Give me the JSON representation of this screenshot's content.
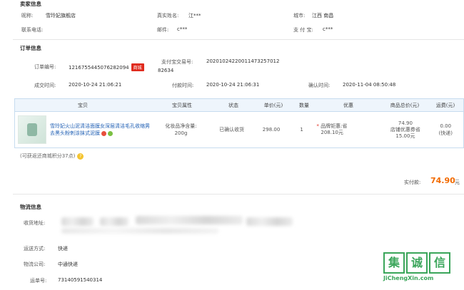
{
  "seller": {
    "title": "卖家信息",
    "nickname_label": "昵称:",
    "nickname_value": "雪玲妃旗舰店",
    "realname_label": "真实姓名:",
    "realname_value": "江***",
    "city_label": "城市:",
    "city_value": "江西 南昌",
    "phone_label": "联系电话:",
    "phone_value": "",
    "email_label": "邮件:",
    "email_value": "c***",
    "alipay_label": "支 付 宝:",
    "alipay_value": "c***"
  },
  "order": {
    "title": "订单信息",
    "order_no_label": "订单编号:",
    "order_no_value": "1216755445076282094",
    "order_badge": "商城",
    "alipay_trade_label": "支付宝交易号:",
    "alipay_trade_value_1": "20201024220011473257012",
    "alipay_trade_value_2": "82634",
    "created_label": "成交时间:",
    "created_value": "2020-10-24 21:06:21",
    "paid_label": "付款时间:",
    "paid_value": "2020-10-24 21:06:31",
    "confirmed_label": "确认时间:",
    "confirmed_value": "2020-11-04 08:50:48"
  },
  "table": {
    "headers": [
      "宝贝",
      "宝贝属性",
      "状态",
      "单价(元)",
      "数量",
      "优惠",
      "商品总价(元)",
      "运费(元)"
    ],
    "row": {
      "title": "雪玲妃火山泥清洁面膜女深层清洁毛孔收缩男去黑头粉刺涂抹式泥膜",
      "attr_1": "化妆品净含量:",
      "attr_2": "200g",
      "status": "已确认收货",
      "price": "298.00",
      "qty": "1",
      "promo_1": "品牌钜惠:省",
      "promo_2": "208.10元",
      "total_1": "74.90",
      "total_2": "店铺优惠券省",
      "total_3": "15.00元",
      "freight_1": "0.00",
      "freight_2": "(快递)"
    }
  },
  "points_note": "(可获返还商城积分37点)",
  "payment": {
    "label": "实付款:",
    "amount": "74.90",
    "unit": "元"
  },
  "logistics": {
    "title": "物流信息",
    "address_label": "收货地址:",
    "method_label": "运送方式:",
    "method_value": "快递",
    "company_label": "物流公司:",
    "company_value": "中通快递",
    "tracking_label": "运单号:",
    "tracking_value": "73140591540314"
  },
  "watermark": {
    "char_1": "集",
    "char_2": "诚",
    "char_3": "信",
    "url": "JiChengXin.com"
  }
}
